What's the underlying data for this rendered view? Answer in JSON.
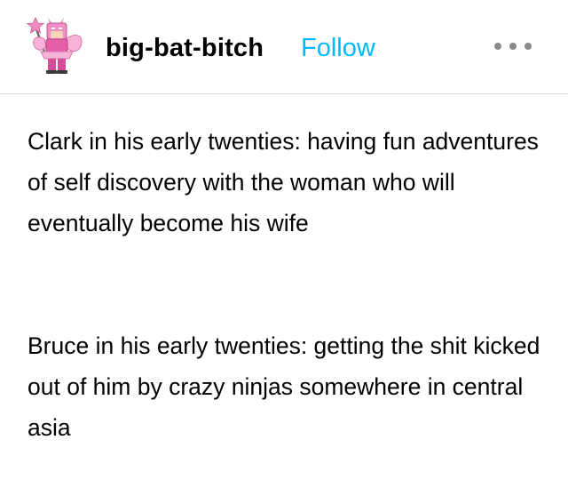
{
  "post": {
    "blog_name": "big-bat-bitch",
    "follow_label": "Follow",
    "more_icon": "more-horizontal-icon",
    "avatar_icon": "lego-batman-fairy-avatar",
    "paragraphs": [
      "Clark in his early twenties: having fun adventures of self discovery with the woman who will eventually become his wife",
      "Bruce in his early twenties: getting the shit kicked out of him by crazy ninjas somewhere in central asia"
    ]
  },
  "colors": {
    "follow": "#00b8ff",
    "divider": "#d9d9d9",
    "avatar_pink": "#f08fc4",
    "more_dots": "#8a8a8a"
  }
}
